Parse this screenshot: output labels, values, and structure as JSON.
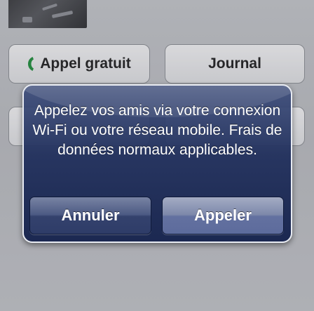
{
  "background": {
    "buttons": {
      "free_call_label": "Appel gratuit",
      "journal_label": "Journal"
    }
  },
  "alert": {
    "message": "Appelez vos amis via votre connexion Wi-Fi ou votre réseau mobile. Frais de données normaux applicables.",
    "cancel_label": "Annuler",
    "call_label": "Appeler"
  },
  "colors": {
    "phone_icon": "#1e8f3a",
    "alert_bg": "#1f2e5c",
    "alert_border": "#e8ebf2"
  },
  "icons": {
    "free_call": "phone-handset-icon"
  }
}
